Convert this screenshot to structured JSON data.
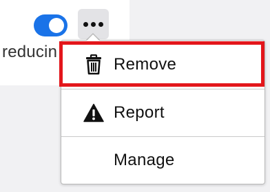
{
  "background": {
    "toggle": {
      "state": "on",
      "color": "#1a73e8"
    },
    "partial_text": "reducin"
  },
  "menu_button": {
    "icon": "more-horizontal-icon"
  },
  "menu": {
    "items": [
      {
        "label": "Remove",
        "icon": "trash-icon"
      },
      {
        "label": "Report",
        "icon": "warning-icon"
      },
      {
        "label": "Manage"
      }
    ]
  },
  "highlight_color": "#e3161b"
}
